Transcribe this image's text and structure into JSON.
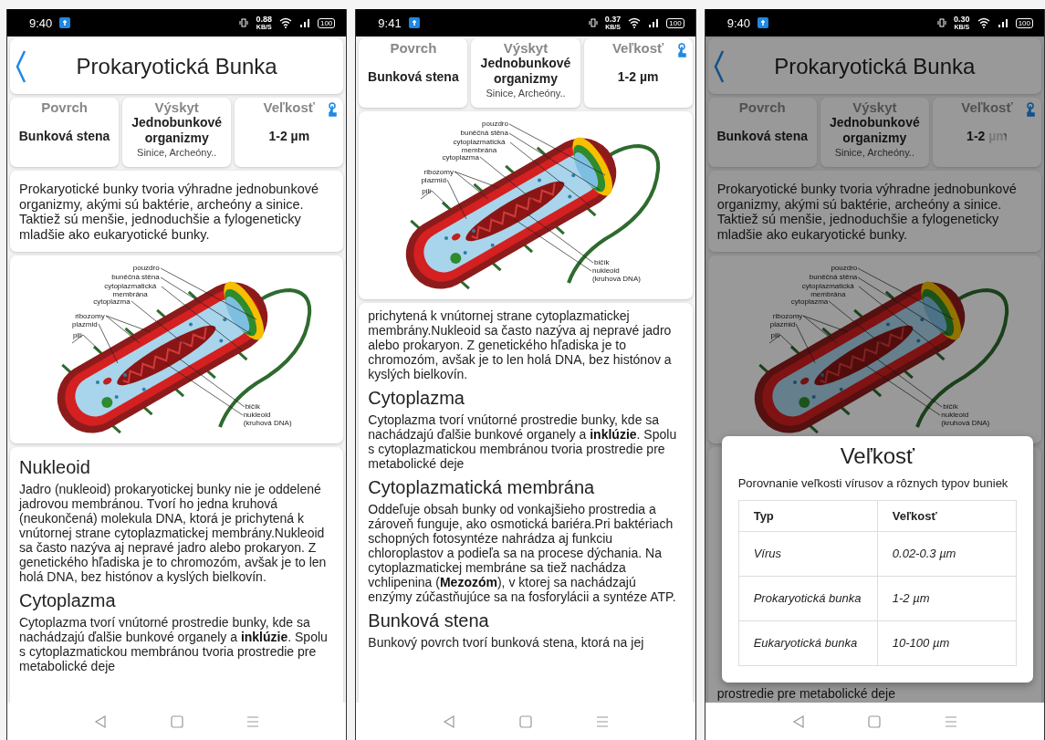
{
  "phones": [
    {
      "status_bar": {
        "time": "9:40",
        "speed": "0.88",
        "speed_unit": "KB/S",
        "battery": "100"
      },
      "header": {
        "title": "Prokaryotická Bunka"
      },
      "info_cards": [
        {
          "label": "Povrch",
          "value": "Bunková stena",
          "touched": false
        },
        {
          "label": "Výskyt",
          "value": "Jednobunkové organizmy",
          "note": "Sinice, Archeóny..",
          "touched": false
        },
        {
          "label": "Veľkosť",
          "value": "1-2 µm",
          "touched": false
        }
      ],
      "intro": "Prokaryotické bunky tvoria výhradne jednobunkové organizmy, akými sú baktérie, archeóny a sinice. Taktiež sú menšie, jednoduchšie a fylogeneticky mladšie ako eukaryotické bunky.",
      "diagram": {
        "labels": [
          "pouzdro",
          "buněčná stěna",
          "cytoplazmatická membrána",
          "cytoplazma",
          "ribozomy",
          "plazmid",
          "pili",
          "bičík",
          "nukleoid (kruhová DNA)"
        ]
      },
      "article": [
        {
          "kind": "heading",
          "text": "Nukleoid"
        },
        {
          "kind": "paragraph",
          "text": "Jadro (nukleoid) prokaryotickej bunky nie je oddelené jadrovou membránou. Tvorí ho jedna kruhová (neukončená) molekula DNA, ktorá je prichytená k vnútornej strane cytoplazmatickej membrány.Nukleoid sa často nazýva aj nepravé jadro alebo prokaryon. Z genetického hľadiska je to chromozóm, avšak je to len holá DNA, bez histónov a kyslých bielkovín."
        },
        {
          "kind": "heading",
          "text": "Cytoplazma"
        },
        {
          "kind": "paragraph",
          "text": "Cytoplazma tvorí vnútorné prostredie bunky, kde sa nachádzajú ďalšie bunkové organely a **inklúzie**. Spolu s cytoplazmatickou membránou tvoria prostredie pre metabolické deje"
        }
      ]
    },
    {
      "status_bar": {
        "time": "9:41",
        "speed": "0.37",
        "speed_unit": "KB/S",
        "battery": "100"
      },
      "info_cards": [
        {
          "label": "Povrch",
          "value": "Bunková stena",
          "touched": false
        },
        {
          "label": "Výskyt",
          "value": "Jednobunkové organizmy",
          "note": "Sinice, Archeóny..",
          "touched": false
        },
        {
          "label": "Veľkosť",
          "value": "1-2 µm",
          "touched": false
        }
      ],
      "diagram": {
        "labels": [
          "pouzdro",
          "buněčná stěna",
          "cytoplazmatická membrána",
          "cytoplazma",
          "ribozomy",
          "plazmid",
          "pili",
          "bičík",
          "nukleoid (kruhová DNA)"
        ]
      },
      "article": [
        {
          "kind": "paragraph",
          "text": "prichytená k vnútornej strane cytoplazmatickej membrány.Nukleoid sa často nazýva aj nepravé jadro alebo prokaryon. Z genetického hľadiska je to chromozóm, avšak je to len holá DNA, bez histónov a kyslých bielkovín."
        },
        {
          "kind": "heading",
          "text": "Cytoplazma"
        },
        {
          "kind": "paragraph",
          "text": "Cytoplazma tvorí vnútorné prostredie bunky, kde sa nachádzajú ďalšie bunkové organely a **inklúzie**. Spolu s cytoplazmatickou membránou tvoria prostredie pre metabolické deje"
        },
        {
          "kind": "heading",
          "text": "Cytoplazmatická membrána"
        },
        {
          "kind": "paragraph",
          "text": "Oddeľuje obsah bunky od vonkajšieho prostredia a zároveň funguje, ako osmotická bariéra.Pri baktériach schopných fotosyntéze nahrádza aj funkciu chloroplastov a podieľa sa na procese dýchania. Na cytoplazmatickej membráne sa tiež nachádza vchlipenina (**Mezozóm**), v ktorej sa nachádzajú enzýmy zúčastňujúce sa na fosforylácii a syntéze ATP."
        },
        {
          "kind": "heading",
          "text": "Bunková stena"
        },
        {
          "kind": "paragraph",
          "text": "Bunkový povrch tvorí bunková stena, ktorá na jej"
        }
      ]
    },
    {
      "status_bar": {
        "time": "9:40",
        "speed": "0.30",
        "speed_unit": "KB/S",
        "battery": "100"
      },
      "header": {
        "title": "Prokaryotická Bunka"
      },
      "info_cards": [
        {
          "label": "Povrch",
          "value": "Bunková stena",
          "touched": false
        },
        {
          "label": "Výskyt",
          "value": "Jednobunkové organizmy",
          "note": "Sinice, Archeóny..",
          "touched": false
        },
        {
          "label": "Veľkosť",
          "value": "1-2 µm",
          "touched": true
        }
      ],
      "intro": "Prokaryotické bunky tvoria výhradne jednobunkové organizmy, akými sú baktérie, archeóny a sinice. Taktiež sú menšie, jednoduchšie a fylogeneticky mladšie ako eukaryotické bunky.",
      "diagram": {
        "labels": [
          "pouzdro",
          "buněčná stěna",
          "cytoplazmatická membrána",
          "cytoplazma",
          "ribozomy",
          "plazmid",
          "pili",
          "bičík",
          "nukleoid (kruhová DNA)"
        ]
      },
      "article": [
        {
          "kind": "paragraph",
          "text": "prostredie pre metabolické deje"
        }
      ],
      "dialog": {
        "title": "Veľkosť",
        "subtitle": "Porovnanie veľkosti vírusov a rôznych typov buniek",
        "table": {
          "columns": [
            "Typ",
            "Veľkosť"
          ],
          "rows": [
            [
              "Vírus",
              "0.02-0.3 µm"
            ],
            [
              "Prokaryotická bunka",
              "1-2 µm"
            ],
            [
              "Eukaryotická bunka",
              "10-100 µm"
            ]
          ]
        }
      }
    }
  ]
}
